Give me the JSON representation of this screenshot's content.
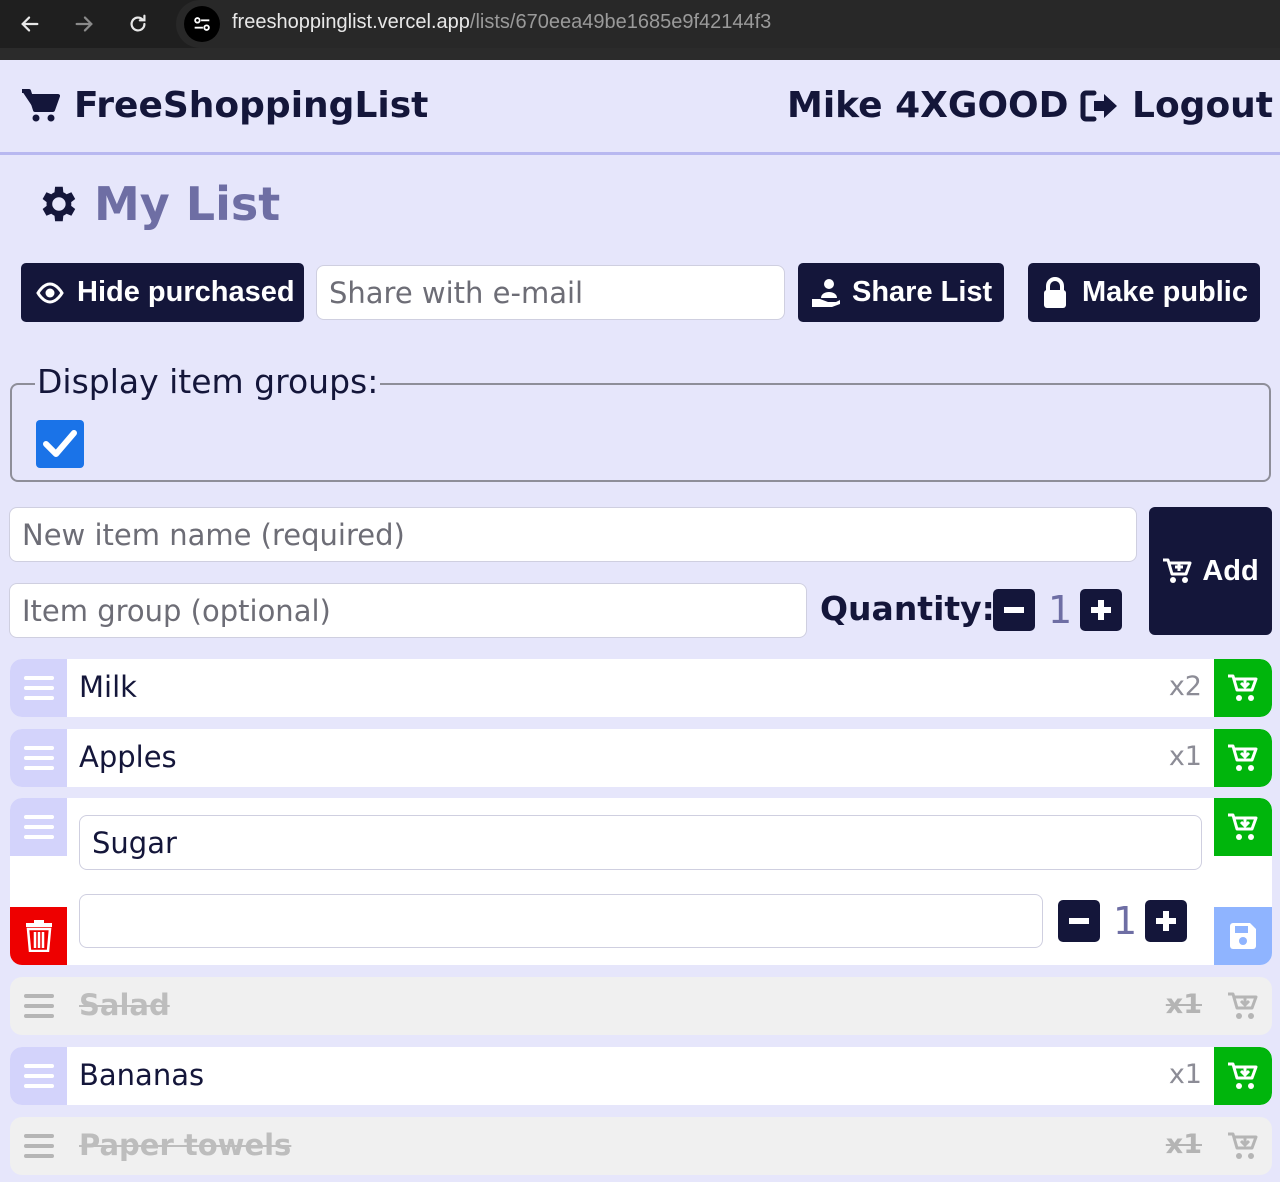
{
  "browser": {
    "url_host": "freeshoppinglist.vercel.app",
    "url_path": "/lists/670eea49be1685e9f42144f3"
  },
  "header": {
    "brand": "FreeShoppingList",
    "user_name": "Mike 4XGOOD",
    "logout_label": "Logout"
  },
  "page": {
    "title": "My List"
  },
  "toolbar": {
    "hide_purchased_label": "Hide purchased",
    "share_email_placeholder": "Share with e-mail",
    "share_list_label": "Share List",
    "make_public_label": "Make public"
  },
  "groups": {
    "legend": "Display item groups:",
    "checked": true
  },
  "add_form": {
    "name_placeholder": "New item name (required)",
    "group_placeholder": "Item group (optional)",
    "quantity_label": "Quantity:",
    "quantity_value": "1",
    "add_label": "Add"
  },
  "items": [
    {
      "name": "Milk",
      "qty": "x2",
      "purchased": false
    },
    {
      "name": "Apples",
      "qty": "x1",
      "purchased": false
    },
    {
      "name": "Sugar",
      "editing": true,
      "group_value": "",
      "qty_value": "1"
    },
    {
      "name": "Salad",
      "qty": "x1",
      "purchased": true
    },
    {
      "name": "Bananas",
      "qty": "x1",
      "purchased": false
    },
    {
      "name": "Paper towels",
      "qty": "x1",
      "purchased": true
    }
  ],
  "colors": {
    "background": "#e6e6fb",
    "dark": "#14163a",
    "cart_green": "#00b50c",
    "delete_red": "#ee0000",
    "save_blue": "#8fb4ff",
    "checkbox_blue": "#1a73e8"
  }
}
